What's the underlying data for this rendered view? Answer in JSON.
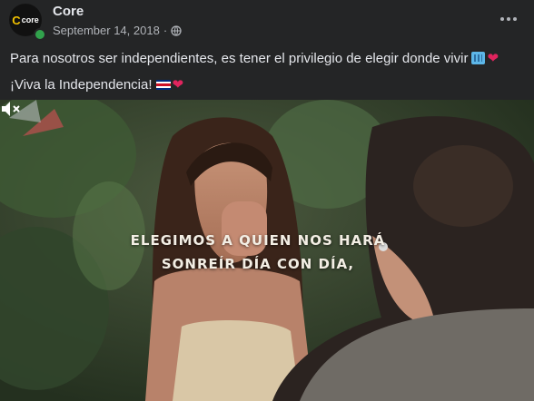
{
  "post": {
    "page_name": "Core",
    "avatar_text": "core",
    "date": "September 14, 2018",
    "separator": "·",
    "privacy_icon": "globe-icon",
    "more_icon": "more-options-icon",
    "text_line1": "Para nosotros ser independientes, es tener el privilegio de elegir donde vivir",
    "text_line2": "¡Viva la Independencia!",
    "emojis": [
      "building-icon",
      "red-heart-icon",
      "costa-rica-flag-icon",
      "red-heart-icon"
    ]
  },
  "video": {
    "caption_line1": "ELEGIMOS A QUIEN NOS HARÁ",
    "caption_line2": "SONREÍR DÍA CON DÍA,",
    "mute_icon": "speaker-muted-icon"
  },
  "colors": {
    "background": "#242526",
    "text": "#e4e6eb",
    "secondary_text": "#b0b3b8",
    "online": "#31a24c",
    "heart": "#e0245e"
  }
}
